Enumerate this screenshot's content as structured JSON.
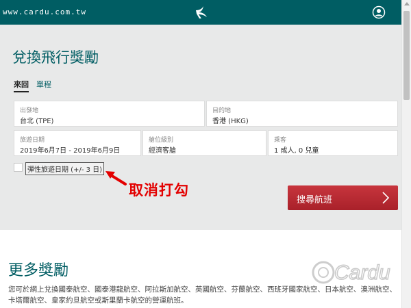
{
  "header": {
    "site_url": "www.cardu.com.tw",
    "logo_icon": "brushwing-logo-icon",
    "user_icon": "user-account-icon",
    "bg_color": "#005d63"
  },
  "page": {
    "title": "兌換飛行獎勵"
  },
  "trip_type": {
    "tabs": [
      {
        "label": "來回",
        "selected": true
      },
      {
        "label": "單程",
        "selected": false
      }
    ]
  },
  "form": {
    "from": {
      "label": "出發地",
      "value": "台北 (TPE)"
    },
    "to": {
      "label": "目的地",
      "value": "香港 (HKG)"
    },
    "dates": {
      "label": "旅遊日期",
      "value": "2019年6月7日 - 2019年6月9日"
    },
    "cabin": {
      "label": "艙位級別",
      "value": "經濟客艙"
    },
    "passengers": {
      "label": "乘客",
      "value": "1 成人, 0 兒童"
    },
    "flexible": {
      "label": "彈性旅遊日期 (+/- 3 日)",
      "checked": false
    },
    "search_button": "搜尋航班"
  },
  "annotation": {
    "text": "取消打勾",
    "color": "#e30000"
  },
  "more_rewards": {
    "title": "更多獎勵",
    "description": "您可於網上兌換國泰航空、國泰港龍航空、阿拉斯加航空、英國航空、芬蘭航空、西班牙國家航空、日本航空、澳洲航空、卡塔爾航空、皇家約旦航空或斯里蘭卡航空的營運航班。"
  },
  "watermark": {
    "text": "Cardu",
    "icon": "cardu-watermark-logo"
  },
  "colors": {
    "accent": "#005d63",
    "button": "#b52a32",
    "panel": "#e8e9e9"
  }
}
